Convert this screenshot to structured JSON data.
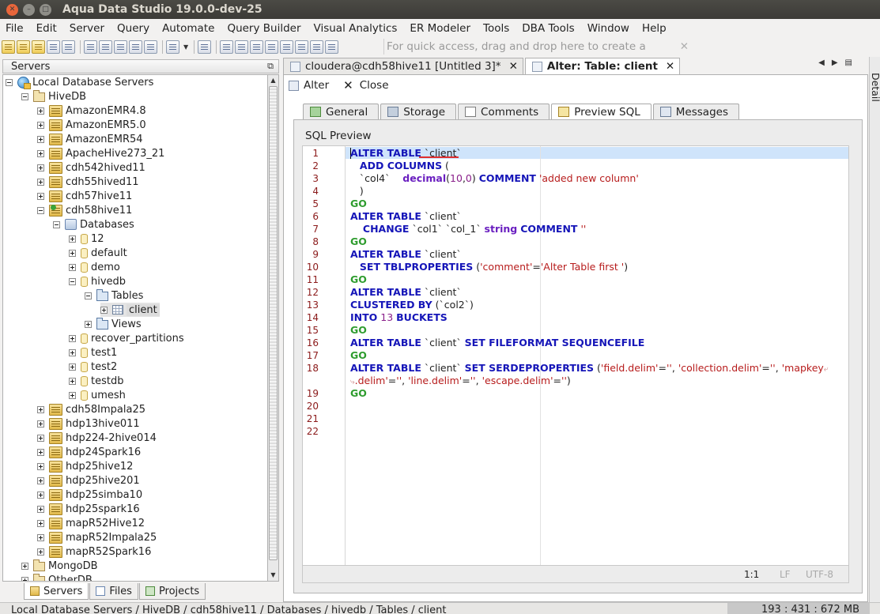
{
  "window": {
    "title": "Aqua Data Studio 19.0.0-dev-25"
  },
  "menu": [
    "File",
    "Edit",
    "Server",
    "Query",
    "Automate",
    "Query Builder",
    "Visual Analytics",
    "ER Modeler",
    "Tools",
    "DBA Tools",
    "Window",
    "Help"
  ],
  "quick_access": {
    "placeholder": "For quick access, drag and drop here to create a shortcut"
  },
  "servers_panel": {
    "title": "Servers",
    "tree": [
      {
        "label": "Local Database Servers",
        "level": 0,
        "expander": "minus",
        "icon": "globe"
      },
      {
        "label": "HiveDB",
        "level": 1,
        "expander": "minus",
        "icon": "folder"
      },
      {
        "label": "AmazonEMR4.8",
        "level": 2,
        "expander": "plus",
        "icon": "server"
      },
      {
        "label": "AmazonEMR5.0",
        "level": 2,
        "expander": "plus",
        "icon": "server"
      },
      {
        "label": "AmazonEMR54",
        "level": 2,
        "expander": "plus",
        "icon": "server"
      },
      {
        "label": "ApacheHive273_21",
        "level": 2,
        "expander": "plus",
        "icon": "server"
      },
      {
        "label": "cdh542hived11",
        "level": 2,
        "expander": "plus",
        "icon": "server"
      },
      {
        "label": "cdh55hived11",
        "level": 2,
        "expander": "plus",
        "icon": "server"
      },
      {
        "label": "cdh57hive11",
        "level": 2,
        "expander": "plus",
        "icon": "server"
      },
      {
        "label": "cdh58hive11",
        "level": 2,
        "expander": "minus",
        "icon": "server-active"
      },
      {
        "label": "Databases",
        "level": 3,
        "expander": "minus",
        "icon": "databases"
      },
      {
        "label": "12",
        "level": 4,
        "expander": "plus",
        "icon": "db"
      },
      {
        "label": "default",
        "level": 4,
        "expander": "plus",
        "icon": "db"
      },
      {
        "label": "demo",
        "level": 4,
        "expander": "plus",
        "icon": "db"
      },
      {
        "label": "hivedb",
        "level": 4,
        "expander": "minus",
        "icon": "db"
      },
      {
        "label": "Tables",
        "level": 5,
        "expander": "minus",
        "icon": "folderblue"
      },
      {
        "label": "client",
        "level": 6,
        "expander": "plus",
        "icon": "table",
        "selected": true
      },
      {
        "label": "Views",
        "level": 5,
        "expander": "plus",
        "icon": "folderblue"
      },
      {
        "label": "recover_partitions",
        "level": 4,
        "expander": "plus",
        "icon": "db"
      },
      {
        "label": "test1",
        "level": 4,
        "expander": "plus",
        "icon": "db"
      },
      {
        "label": "test2",
        "level": 4,
        "expander": "plus",
        "icon": "db"
      },
      {
        "label": "testdb",
        "level": 4,
        "expander": "plus",
        "icon": "db"
      },
      {
        "label": "umesh",
        "level": 4,
        "expander": "plus",
        "icon": "db"
      },
      {
        "label": "cdh58Impala25",
        "level": 2,
        "expander": "plus",
        "icon": "server"
      },
      {
        "label": "hdp13hive011",
        "level": 2,
        "expander": "plus",
        "icon": "server"
      },
      {
        "label": "hdp224-2hive014",
        "level": 2,
        "expander": "plus",
        "icon": "server"
      },
      {
        "label": "hdp24Spark16",
        "level": 2,
        "expander": "plus",
        "icon": "server"
      },
      {
        "label": "hdp25hive12",
        "level": 2,
        "expander": "plus",
        "icon": "server"
      },
      {
        "label": "hdp25hive201",
        "level": 2,
        "expander": "plus",
        "icon": "server"
      },
      {
        "label": "hdp25simba10",
        "level": 2,
        "expander": "plus",
        "icon": "server"
      },
      {
        "label": "hdp25spark16",
        "level": 2,
        "expander": "plus",
        "icon": "server"
      },
      {
        "label": "mapR52Hive12",
        "level": 2,
        "expander": "plus",
        "icon": "server"
      },
      {
        "label": "mapR52Impala25",
        "level": 2,
        "expander": "plus",
        "icon": "server"
      },
      {
        "label": "mapR52Spark16",
        "level": 2,
        "expander": "plus",
        "icon": "server"
      },
      {
        "label": "MongoDB",
        "level": 1,
        "expander": "plus",
        "icon": "folder"
      },
      {
        "label": "OtherDB",
        "level": 1,
        "expander": "plus",
        "icon": "folder"
      }
    ],
    "bottom_tabs": [
      {
        "label": "Servers",
        "icon": "srv",
        "active": true
      },
      {
        "label": "Files",
        "icon": "fil"
      },
      {
        "label": "Projects",
        "icon": "prj"
      }
    ]
  },
  "doc_tabs": [
    {
      "label": "cloudera@cdh58hive11 [Untitled 3]*",
      "active": false
    },
    {
      "label": "Alter: Table: client",
      "active": true
    }
  ],
  "detail_label": "Detail",
  "actions": {
    "alter": "Alter",
    "close": "Close"
  },
  "sub_tabs": [
    {
      "label": "General",
      "icon": "g"
    },
    {
      "label": "Storage",
      "icon": "s"
    },
    {
      "label": "Comments",
      "icon": "c"
    },
    {
      "label": "Preview SQL",
      "icon": "p",
      "active": true
    },
    {
      "label": "Messages",
      "icon": "m"
    }
  ],
  "sql_preview": {
    "title": "SQL Preview",
    "line_numbers": [
      "1",
      "2",
      "3",
      "4",
      "5",
      "6",
      "7",
      "8",
      "9",
      "10",
      "11",
      "12",
      "13",
      "14",
      "15",
      "16",
      "17",
      "18",
      "",
      "19",
      "20",
      "21",
      "22"
    ],
    "lines": [
      [
        [
          "kw",
          "ALTER TABLE"
        ],
        [
          "t",
          " `client`"
        ]
      ],
      [
        [
          "t",
          "   "
        ],
        [
          "kw",
          "ADD COLUMNS"
        ],
        [
          "t",
          " ("
        ]
      ],
      [
        [
          "t",
          "   `col4`    "
        ],
        [
          "typ",
          "decimal"
        ],
        [
          "t",
          "("
        ],
        [
          "num",
          "10"
        ],
        [
          "t",
          ","
        ],
        [
          "num",
          "0"
        ],
        [
          "t",
          ") "
        ],
        [
          "kw",
          "COMMENT"
        ],
        [
          "t",
          " "
        ],
        [
          "str",
          "'added new column'"
        ]
      ],
      [
        [
          "t",
          "   )"
        ]
      ],
      [
        [
          "go",
          "GO"
        ]
      ],
      [
        [
          "kw",
          "ALTER TABLE"
        ],
        [
          "t",
          " `client`"
        ]
      ],
      [
        [
          "t",
          "    "
        ],
        [
          "kw",
          "CHANGE"
        ],
        [
          "t",
          " `col1` `col_1` "
        ],
        [
          "typ",
          "string"
        ],
        [
          "t",
          " "
        ],
        [
          "kw",
          "COMMENT"
        ],
        [
          "t",
          " "
        ],
        [
          "str",
          "''"
        ]
      ],
      [
        [
          "go",
          "GO"
        ]
      ],
      [
        [
          "kw",
          "ALTER TABLE"
        ],
        [
          "t",
          " `client`"
        ]
      ],
      [
        [
          "t",
          "   "
        ],
        [
          "kw",
          "SET TBLPROPERTIES"
        ],
        [
          "t",
          " ("
        ],
        [
          "str",
          "'comment'"
        ],
        [
          "t",
          "="
        ],
        [
          "str",
          "'Alter Table first '"
        ],
        [
          "t",
          ")"
        ]
      ],
      [
        [
          "go",
          "GO"
        ]
      ],
      [
        [
          "kw",
          "ALTER TABLE"
        ],
        [
          "t",
          " `client`"
        ]
      ],
      [
        [
          "kw",
          "CLUSTERED BY"
        ],
        [
          "t",
          " (`col2`)"
        ]
      ],
      [
        [
          "kw",
          "INTO"
        ],
        [
          "t",
          " "
        ],
        [
          "num",
          "13"
        ],
        [
          "t",
          " "
        ],
        [
          "kw",
          "BUCKETS"
        ]
      ],
      [
        [
          "go",
          "GO"
        ]
      ],
      [
        [
          "kw",
          "ALTER TABLE"
        ],
        [
          "t",
          " `client` "
        ],
        [
          "kw",
          "SET FILEFORMAT SEQUENCEFILE"
        ]
      ],
      [
        [
          "go",
          "GO"
        ]
      ],
      [
        [
          "kw",
          "ALTER TABLE"
        ],
        [
          "t",
          " `client` "
        ],
        [
          "kw",
          "SET SERDEPROPERTIES"
        ],
        [
          "t",
          " ("
        ],
        [
          "str",
          "'field.delim'"
        ],
        [
          "t",
          "="
        ],
        [
          "str",
          "''"
        ],
        [
          "t",
          ", "
        ],
        [
          "str",
          "'collection.delim'"
        ],
        [
          "t",
          "="
        ],
        [
          "str",
          "''"
        ],
        [
          "t",
          ", "
        ],
        [
          "str",
          "'mapkey"
        ],
        [
          "w",
          "⤶"
        ]
      ],
      [
        [
          "w",
          "⤷"
        ],
        [
          "str",
          ".delim'"
        ],
        [
          "t",
          "="
        ],
        [
          "str",
          "''"
        ],
        [
          "t",
          ", "
        ],
        [
          "str",
          "'line.delim'"
        ],
        [
          "t",
          "="
        ],
        [
          "str",
          "''"
        ],
        [
          "t",
          ", "
        ],
        [
          "str",
          "'escape.delim'"
        ],
        [
          "t",
          "="
        ],
        [
          "str",
          "''"
        ],
        [
          "t",
          ")"
        ]
      ],
      [
        [
          "go",
          "GO"
        ]
      ],
      [],
      [],
      []
    ],
    "status": {
      "position": "1:1",
      "line_ending": "LF",
      "encoding": "UTF-8"
    }
  },
  "status_bar": {
    "path": "Local Database Servers / HiveDB / cdh58hive11 / Databases / hivedb / Tables / client",
    "memory": "193 : 431 : 672 MB"
  }
}
